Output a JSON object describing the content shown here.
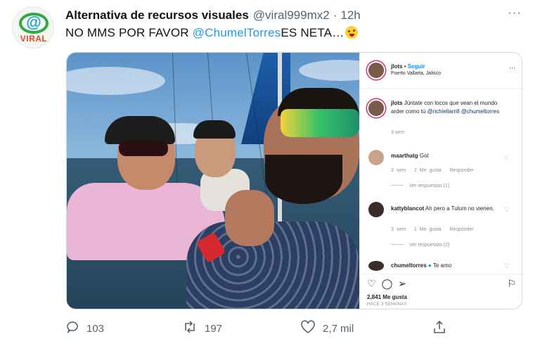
{
  "tweet": {
    "avatar_text": "VIRAL",
    "display_name": "Alternativa de recursos visuales",
    "handle": "@viral999mx2",
    "separator": "·",
    "time": "12h",
    "more_glyph": "···",
    "text_before": "NO MMS POR FAVOR ",
    "mention": "@ChumelTorres",
    "text_after": "ES NETA…",
    "emoji": "zany-face"
  },
  "embed": {
    "account": "jlots",
    "follow": "Seguir",
    "location": "Puerto Vallarta, Jalisco",
    "caption_user": "jlots",
    "caption_text": "Júntate con locos que vean el mundo arder como tú",
    "caption_mention1": "@richieliarrill",
    "caption_mention2": "@chumeltorres",
    "caption_time": "3 sem",
    "comments": [
      {
        "user": "maarthatg",
        "text": "Gol",
        "time": "3 sem",
        "likes": "2 Me gusta",
        "reply": "Responder",
        "view": "Ver respuestas (1)"
      },
      {
        "user": "kattyblancot",
        "text": "Ah pero a Tulum no vienen.",
        "time": "3 sem",
        "likes": "1 Me gusta",
        "reply": "Responder",
        "view": "Ver respuestas (2)"
      },
      {
        "user": "chumeltorres",
        "text": "Te amo"
      }
    ],
    "likes_count": "2,841 Me gusta",
    "timestamp": "HACE 3 SEMANAS"
  },
  "actions": {
    "replies": "103",
    "retweets": "197",
    "likes": "2,7 mil"
  },
  "colors": {
    "link": "#1d9bf0",
    "secondary": "#536471",
    "ig_blue": "#0095f6"
  }
}
